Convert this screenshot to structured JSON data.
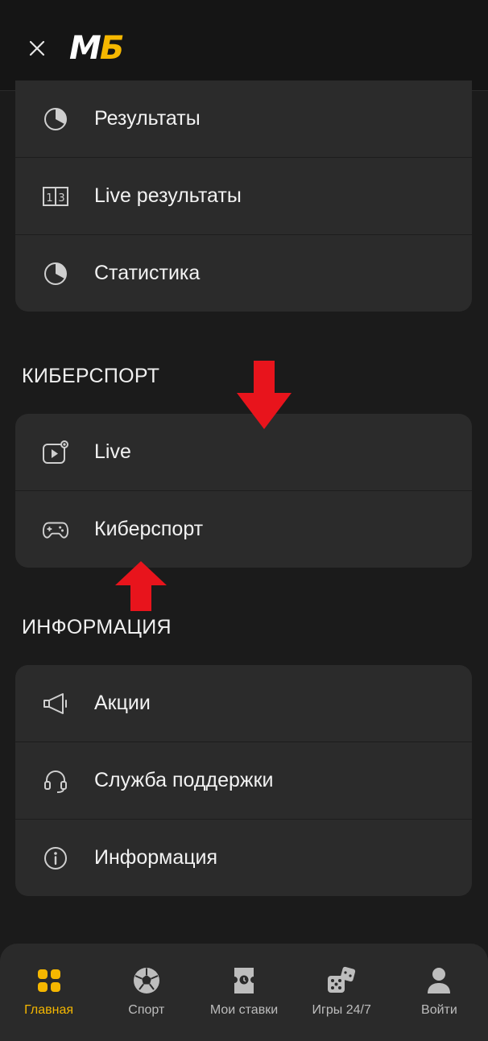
{
  "header": {
    "close_label": "×",
    "logo": {
      "part1": "M",
      "part2": "Б"
    }
  },
  "results_card": {
    "items": [
      {
        "label": "Результаты",
        "icon": "pie-chart-icon"
      },
      {
        "label": "Live результаты",
        "icon": "scoreboard-icon"
      },
      {
        "label": "Статистика",
        "icon": "pie-chart-icon"
      }
    ]
  },
  "esports_section": {
    "title": "КИБЕРСПОРТ",
    "items": [
      {
        "label": "Live",
        "icon": "live-video-icon"
      },
      {
        "label": "Киберспорт",
        "icon": "gamepad-icon"
      }
    ]
  },
  "info_section": {
    "title": "ИНФОРМАЦИЯ",
    "items": [
      {
        "label": "Акции",
        "icon": "megaphone-icon"
      },
      {
        "label": "Служба поддержки",
        "icon": "headset-icon"
      },
      {
        "label": "Информация",
        "icon": "info-icon"
      }
    ]
  },
  "bottom_nav": {
    "items": [
      {
        "label": "Главная",
        "icon": "home-grid-icon",
        "active": true
      },
      {
        "label": "Спорт",
        "icon": "soccer-ball-icon",
        "active": false
      },
      {
        "label": "Мои ставки",
        "icon": "ticket-icon",
        "active": false
      },
      {
        "label": "Игры 24/7",
        "icon": "dice-icon",
        "active": false
      },
      {
        "label": "Войти",
        "icon": "user-icon",
        "active": false
      }
    ]
  },
  "colors": {
    "background": "#1b1b1b",
    "card": "#2b2b2b",
    "accent": "#f5b700",
    "annotation_arrow": "#e8141c"
  }
}
